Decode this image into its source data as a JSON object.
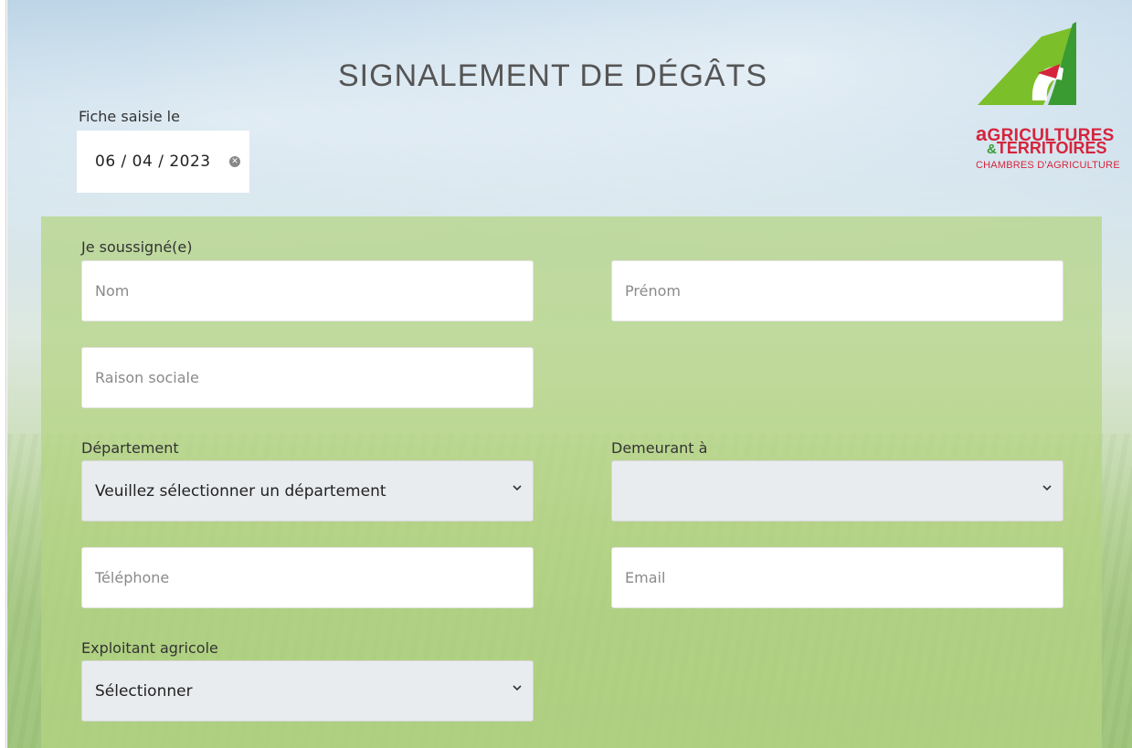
{
  "header": {
    "title": "SIGNALEMENT DE DÉGÂTS",
    "date_label": "Fiche saisie le",
    "date_value": "06 / 04 / 2023"
  },
  "logo": {
    "line1_initial": "a",
    "line1_rest": "GRICULTURES",
    "line2_amp": "&",
    "line2_rest": "TERRITOIRES",
    "line3": "CHAMBRES D'AGRICULTURE",
    "colors": {
      "green": "#7bbf2a",
      "red": "#d6243c",
      "dark_green": "#3a9b33"
    }
  },
  "form": {
    "section_label": "Je soussigné(e)",
    "nom_placeholder": "Nom",
    "prenom_placeholder": "Prénom",
    "raison_sociale_placeholder": "Raison sociale",
    "departement_label": "Département",
    "departement_value": "Veuillez sélectionner un département",
    "demeurant_label": "Demeurant à",
    "demeurant_value": "",
    "telephone_placeholder": "Téléphone",
    "email_placeholder": "Email",
    "exploitant_label": "Exploitant agricole",
    "exploitant_value": "Sélectionner"
  }
}
